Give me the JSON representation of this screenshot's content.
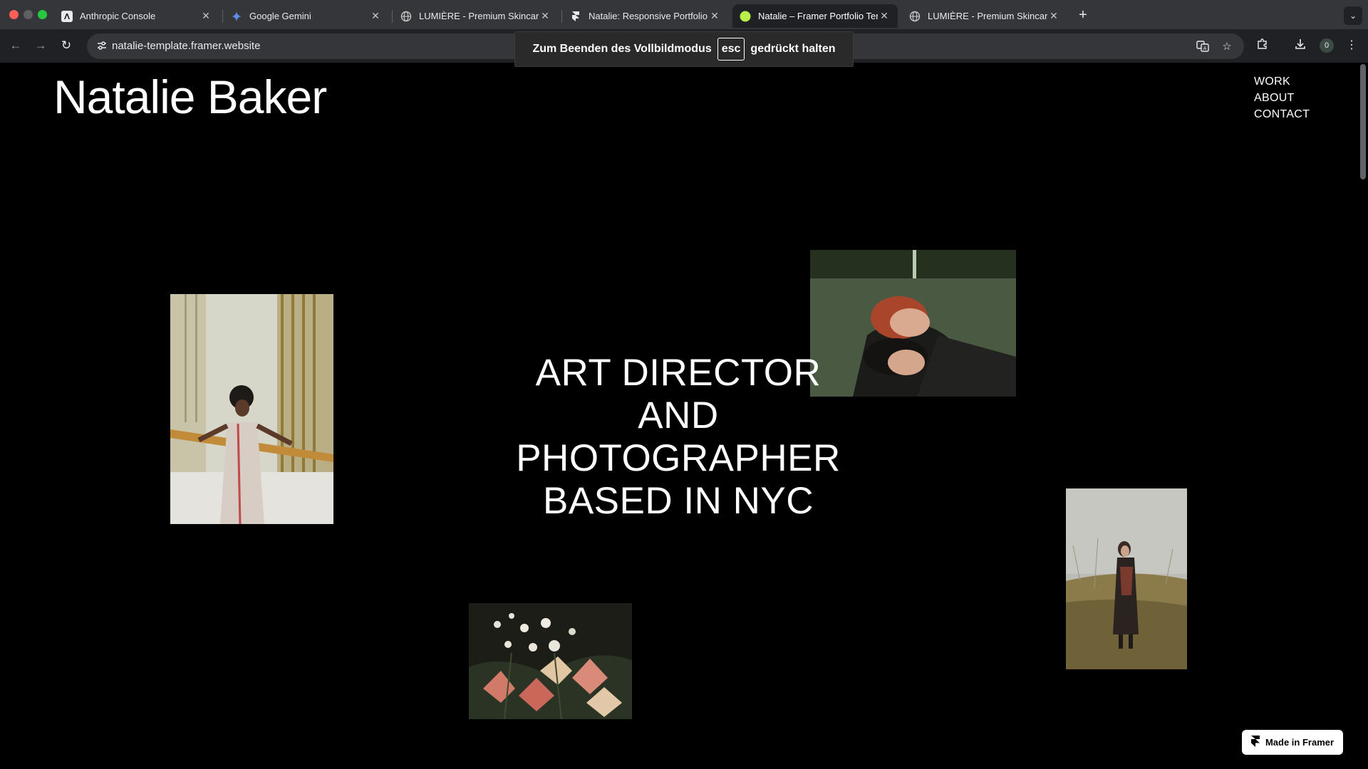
{
  "browser": {
    "tabs": [
      {
        "title": "Anthropic Console",
        "icon": "anthropic-icon",
        "active": false
      },
      {
        "title": "Google Gemini",
        "icon": "gemini-icon",
        "active": false
      },
      {
        "title": "LUMIÈRE - Premium Skincare",
        "icon": "globe-icon",
        "active": false
      },
      {
        "title": "Natalie: Responsive Portfolio",
        "icon": "framer-icon",
        "active": false
      },
      {
        "title": "Natalie – Framer Portfolio Tem",
        "icon": "natalie-favicon-icon",
        "active": true
      },
      {
        "title": "LUMIÈRE - Premium Skincare",
        "icon": "globe-icon",
        "active": false
      }
    ],
    "url": "natalie-template.framer.website",
    "profile_count": "0",
    "fullscreen_notice": {
      "before": "Zum Beenden des Vollbildmodus",
      "key": "esc",
      "after": "gedrückt halten"
    }
  },
  "site": {
    "brand": "Natalie Baker",
    "nav": [
      "WORK",
      "ABOUT",
      "CONTACT"
    ],
    "hero_lines": [
      "ART DIRECTOR",
      "AND PHOTOGRAPHER",
      "BASED IN NYC"
    ],
    "photos": [
      {
        "name": "photo-woman-balcony",
        "subject": "woman leaning on balcony railing"
      },
      {
        "name": "photo-two-women-lying",
        "subject": "two women lying on grass"
      },
      {
        "name": "photo-woman-field",
        "subject": "woman standing in grassy field"
      },
      {
        "name": "photo-flowers",
        "subject": "flower bouquet"
      }
    ],
    "badge": "Made in Framer"
  },
  "colors": {
    "page_bg": "#000000",
    "text": "#ffffff",
    "active_favicon": "#b8f04a"
  }
}
